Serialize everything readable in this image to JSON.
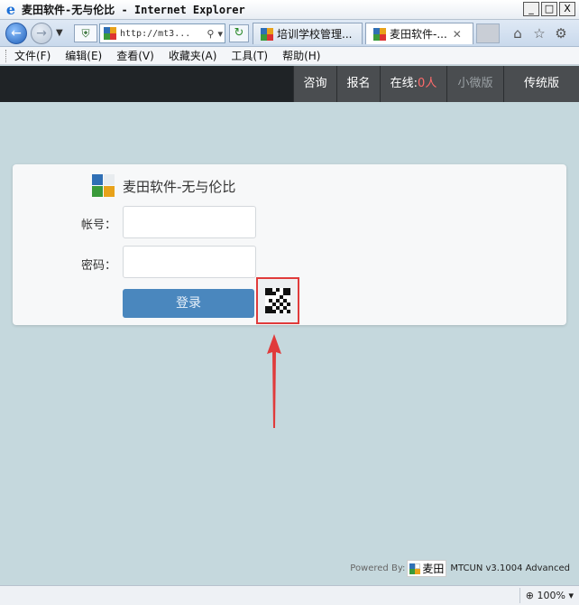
{
  "window": {
    "title": "麦田软件-无与伦比 - Internet Explorer",
    "btn_minimize": "_",
    "btn_restore": "□",
    "btn_close": "X"
  },
  "browser": {
    "address": "http://mt3...",
    "tabs": [
      {
        "label": "培训学校管理..."
      },
      {
        "label": "麦田软件-..."
      }
    ]
  },
  "menu": {
    "items": [
      "文件(F)",
      "编辑(E)",
      "查看(V)",
      "收藏夹(A)",
      "工具(T)",
      "帮助(H)"
    ]
  },
  "header": {
    "consult": "咨询",
    "signup": "报名",
    "online_label": "在线:",
    "online_count": "0人",
    "mini": "小微版",
    "classic": "传统版"
  },
  "login": {
    "brand": "麦田软件-无与伦比",
    "account_label": "帐号：",
    "password_label": "密码：",
    "account_value": "",
    "password_value": "",
    "login_button": "登录"
  },
  "footer": {
    "powered_by": "Powered By:",
    "logo_text": "麦田",
    "version": "MTCUN v3.1004 Advanced"
  },
  "status": {
    "zoom": "100%"
  },
  "colors": {
    "accent_red": "#e03b3b",
    "button_blue": "#4a87be",
    "header_dark": "#1f2326",
    "page_bg": "#c5d8dd"
  }
}
